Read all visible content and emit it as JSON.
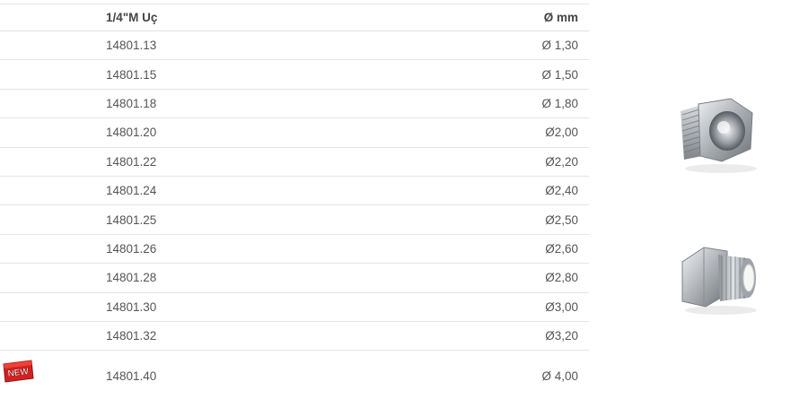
{
  "table": {
    "headers": {
      "code": "1/4\"M Uç",
      "diameter": "Ø mm"
    },
    "rows": [
      {
        "code": "14801.13",
        "diameter": "Ø 1,30"
      },
      {
        "code": "14801.15",
        "diameter": "Ø 1,50"
      },
      {
        "code": "14801.18",
        "diameter": "Ø 1,80"
      },
      {
        "code": "14801.20",
        "diameter": "Ø2,00"
      },
      {
        "code": "14801.22",
        "diameter": "Ø2,20"
      },
      {
        "code": "14801.24",
        "diameter": "Ø2,40"
      },
      {
        "code": "14801.25",
        "diameter": "Ø2,50"
      },
      {
        "code": "14801.26",
        "diameter": "Ø2,60"
      },
      {
        "code": "14801.28",
        "diameter": "Ø2,80"
      },
      {
        "code": "14801.30",
        "diameter": "Ø3,00"
      },
      {
        "code": "14801.32",
        "diameter": "Ø3,20"
      },
      {
        "code": "14801.40",
        "diameter": "Ø 4,00"
      }
    ]
  },
  "badge": {
    "text": "NEW",
    "color": "#d42020"
  },
  "images": {
    "nozzle_front": "hex-nozzle-front-image",
    "nozzle_side": "hex-nozzle-side-image"
  },
  "colors": {
    "text": "#555555",
    "divider": "#e4e4e4",
    "metal": "#b9bcc0"
  }
}
